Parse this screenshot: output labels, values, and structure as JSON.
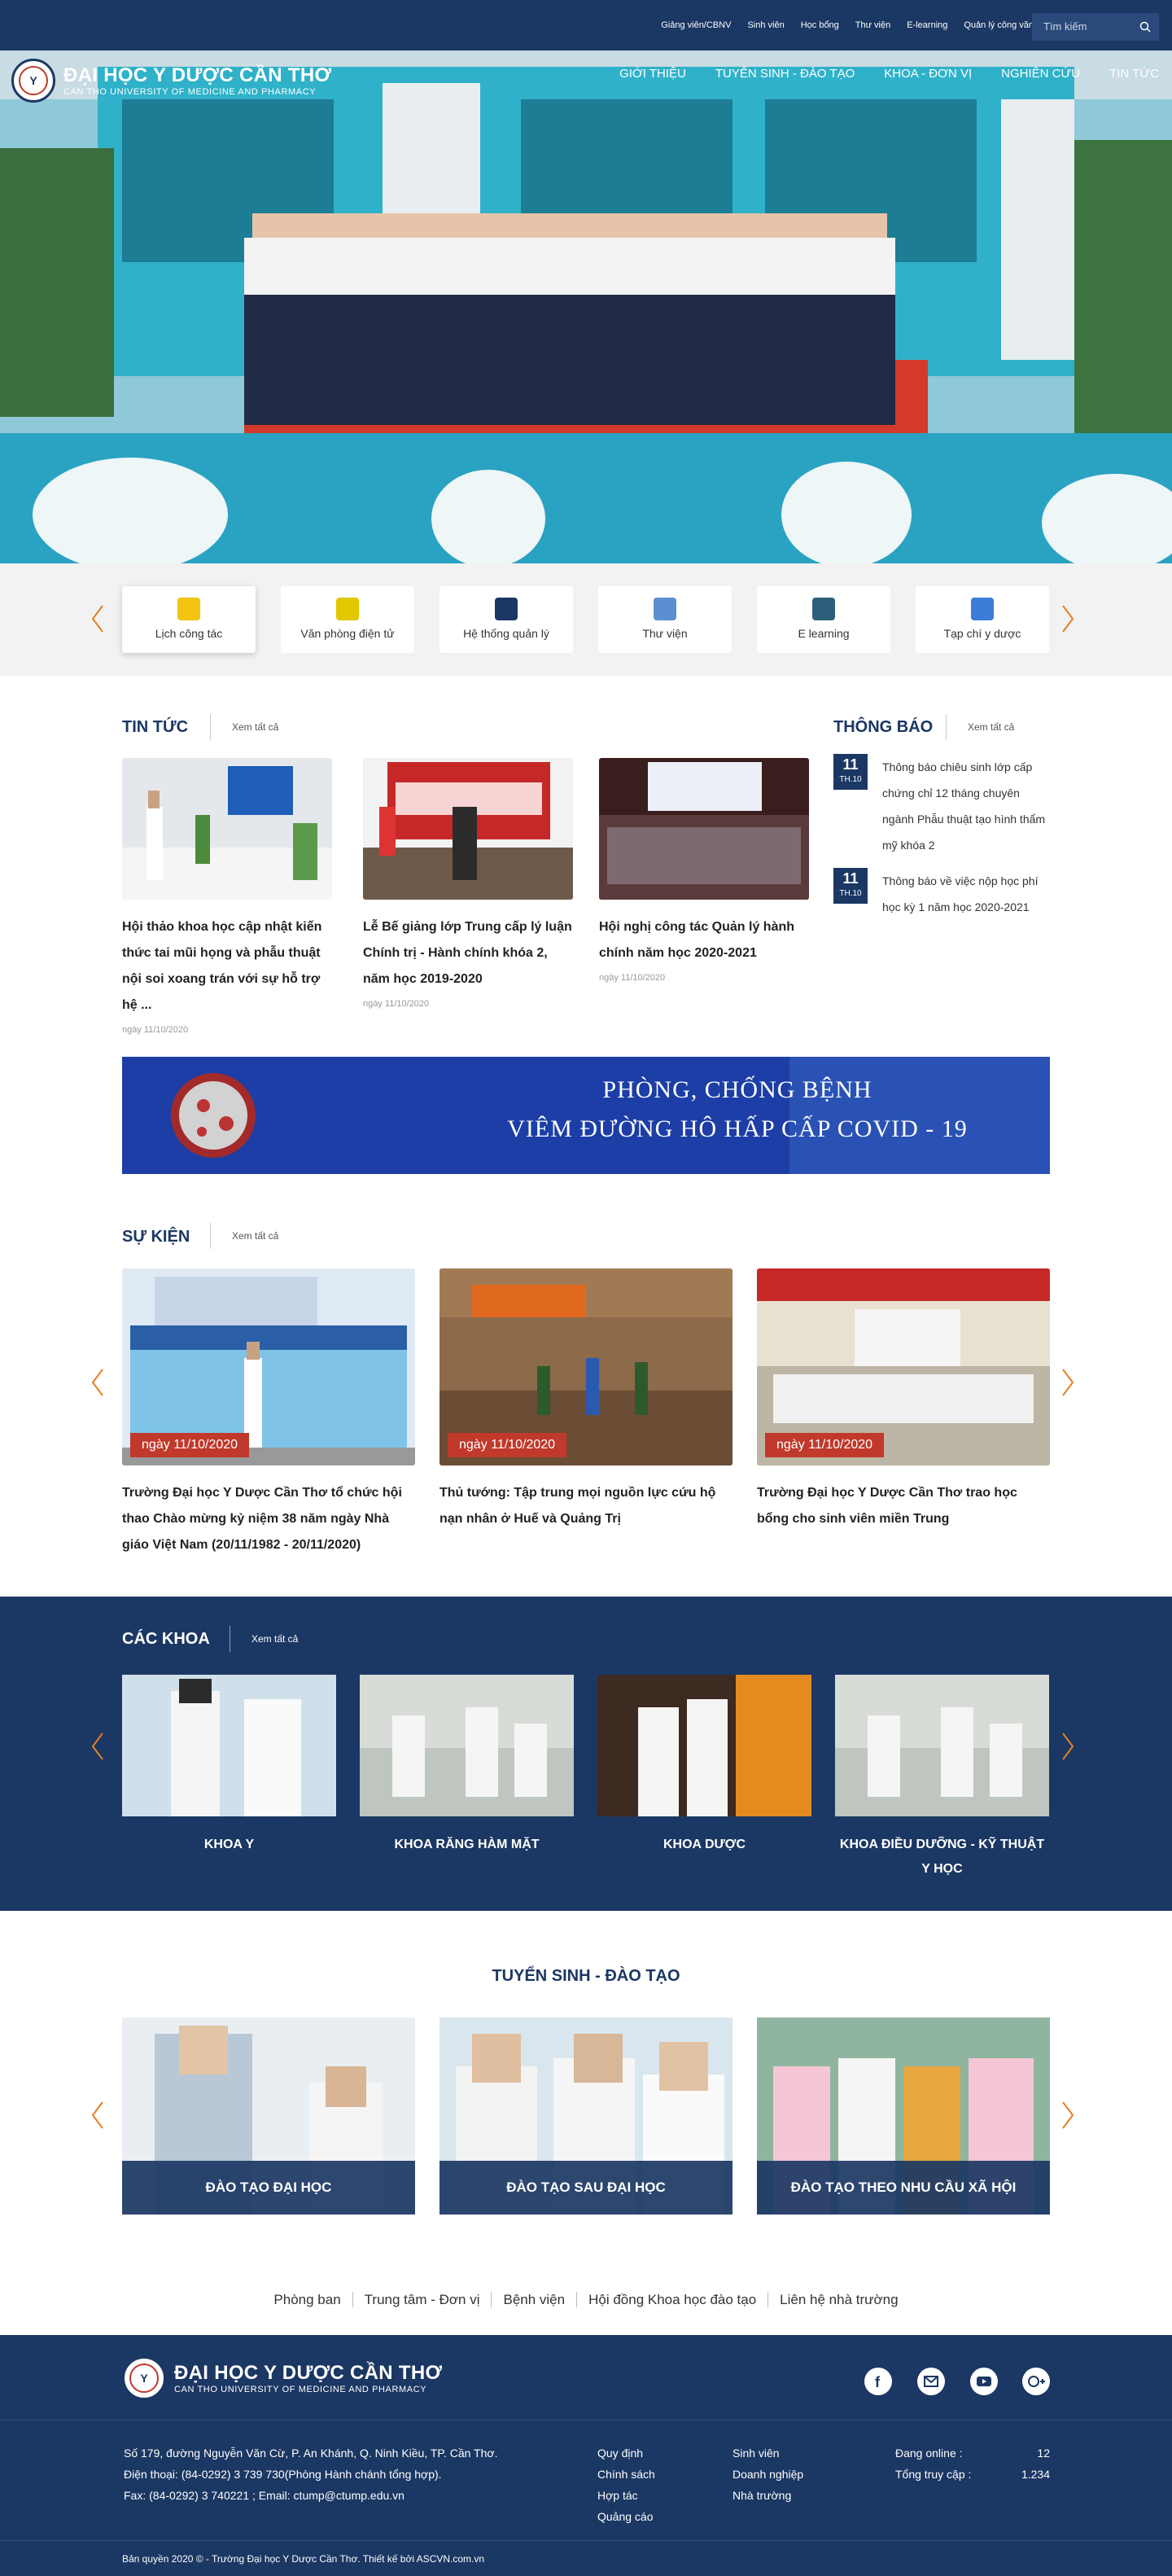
{
  "topbar": {
    "links": [
      "Giảng viên/CBNV",
      "Sinh viên",
      "Học bổng",
      "Thư viện",
      "E-learning",
      "Quản lý công văn"
    ],
    "search_placeholder": "Tìm kiếm"
  },
  "brand": {
    "logo_text": "Y",
    "name": "ĐẠI HỌC Y DƯỢC CẦN THƠ",
    "sub": "CAN THO UNIVERSITY OF MEDICINE AND PHARMACY"
  },
  "nav": [
    "GIỚI THIỆU",
    "TUYỂN SINH - ĐÀO TẠO",
    "KHOA - ĐƠN VỊ",
    "NGHIÊN CỨU",
    "TIN TỨC"
  ],
  "quick": [
    {
      "label": "Lịch công tác",
      "color": "#f1c40f"
    },
    {
      "label": "Văn phòng điện tử",
      "color": "#e1c800"
    },
    {
      "label": "Hệ thống quản lý",
      "color": "#1b3763"
    },
    {
      "label": "Thư viện",
      "color": "#5b8fd1"
    },
    {
      "label": "E learning",
      "color": "#2e5f7a"
    },
    {
      "label": "Tạp chí y dược",
      "color": "#3b7dd8"
    }
  ],
  "news": {
    "title": "TIN TỨC",
    "see_all": "Xem tất cả",
    "items": [
      {
        "title": "Hội thảo khoa học cập nhật kiến thức tai mũi họng và phẫu thuật nội soi xoang trán với sự hỗ trợ hệ ...",
        "date": "ngày 11/10/2020"
      },
      {
        "title": "Lễ Bế giảng lớp Trung cấp lý luận Chính trị - Hành chính khóa 2, năm học 2019-2020",
        "date": "ngày 11/10/2020"
      },
      {
        "title": "Hội nghị công tác Quản lý hành chính năm học 2020-2021",
        "date": "ngày 11/10/2020"
      }
    ]
  },
  "notices": {
    "title": "THÔNG BÁO",
    "see_all": "Xem tất cả",
    "items": [
      {
        "day": "11",
        "month": "TH.10",
        "text": "Thông báo chiêu sinh lớp cấp chứng chỉ 12 tháng chuyên ngành Phẫu thuật tạo hình thẩm mỹ khóa 2"
      },
      {
        "day": "11",
        "month": "TH.10",
        "text": "Thông báo về việc nộp học phí học kỳ 1 năm học 2020-2021"
      }
    ]
  },
  "covid": {
    "line1": "PHÒNG, CHỐNG BỆNH",
    "line2": "VIÊM ĐƯỜNG HÔ HẤP CẤP COVID - 19"
  },
  "events": {
    "title": "SỰ KIỆN",
    "see_all": "Xem tất cả",
    "items": [
      {
        "date": "ngày 11/10/2020",
        "title": "Trường Đại học Y Dược Cần Thơ tổ chức hội thao Chào mừng kỷ niệm 38 năm ngày Nhà giáo Việt Nam (20/11/1982 - 20/11/2020)"
      },
      {
        "date": "ngày 11/10/2020",
        "title": "Thủ tướng: Tập trung mọi nguồn lực cứu hộ nạn nhân ở Huế và Quảng Trị"
      },
      {
        "date": "ngày 11/10/2020",
        "title": "Trường Đại học Y Dược Cần Thơ trao học bổng cho sinh viên miền Trung"
      }
    ]
  },
  "faculties": {
    "title": "CÁC KHOA",
    "see_all": "Xem tất cả",
    "items": [
      "KHOA Y",
      "KHOA RĂNG HÀM MẶT",
      "KHOA DƯỢC",
      "KHOA ĐIỀU DƯỠNG - KỸ THUẬT Y HỌC"
    ]
  },
  "admission": {
    "title": "TUYỂN SINH - ĐÀO TẠO",
    "items": [
      "ĐÀO TẠO ĐẠI HỌC",
      "ĐÀO TẠO SAU ĐẠI HỌC",
      "ĐÀO TẠO THEO NHU CẦU XÃ HỘI"
    ]
  },
  "footer_links": [
    "Phòng ban",
    "Trung tâm - Đơn vị",
    "Bệnh viện",
    "Hội đồng Khoa học đào tạo",
    "Liên hệ nhà trường"
  ],
  "footer": {
    "address": "Số 179, đường Nguyễn Văn Cừ, P. An Khánh, Q. Ninh Kiều, TP. Cần Thơ.",
    "phone": "Điện thoại: (84-0292) 3 739 730(Phòng Hành chánh tổng hợp).",
    "fax": "Fax: (84-0292) 3 740221 ; Email: ctump@ctump.edu.vn",
    "col1": [
      "Quy định",
      "Chính sách",
      "Hợp tác",
      "Quảng cáo"
    ],
    "col2": [
      "Sinh viên",
      "Doanh nghiệp",
      "Nhà trường"
    ],
    "online_label": "Đang online :",
    "online_value": "12",
    "visits_label": "Tổng truy cập :",
    "visits_value": "1.234",
    "copyright": "Bản quyền 2020 © - Trường Đại học Y Dược Cần Thơ. Thiết kế bởi ASCVN.com.vn",
    "social": [
      "facebook-icon",
      "email-icon",
      "youtube-icon",
      "google-plus-icon"
    ]
  }
}
